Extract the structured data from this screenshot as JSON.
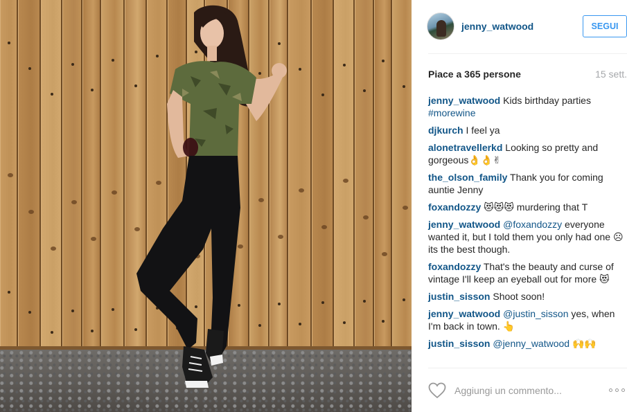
{
  "post": {
    "username": "jenny_watwood",
    "follow_label": "SEGUI",
    "likes_text": "Piace a 365 persone",
    "time_ago": "15 sett."
  },
  "comments": [
    {
      "user": "jenny_watwood",
      "text": "Kids birthday parties ",
      "tag": "#morewine"
    },
    {
      "user": "djkurch",
      "text": "I feel ya"
    },
    {
      "user": "alonetravellerkd",
      "text": "Looking so pretty and gorgeous👌👌✌"
    },
    {
      "user": "the_olson_family",
      "text": "Thank you for coming auntie Jenny"
    },
    {
      "user": "foxandozzy",
      "text": "😻😻😻 murdering that T"
    },
    {
      "user": "jenny_watwood",
      "mention": "@foxandozzy",
      "text": " everyone wanted it, but I told them you only had one ☹ its the best though."
    },
    {
      "user": "foxandozzy",
      "text": "That's the beauty and curse of vintage I'll keep an eyeball out for more 😻"
    },
    {
      "user": "justin_sisson",
      "text": "Shoot soon!"
    },
    {
      "user": "jenny_watwood",
      "mention": "@justin_sisson",
      "text": " yes, when I'm back in town. 👆"
    },
    {
      "user": "justin_sisson",
      "mention": "@jenny_watwood",
      "text": " 🙌🙌"
    }
  ],
  "footer": {
    "comment_placeholder": "Aggiungi un commento...",
    "like_icon": "heart-outline-icon",
    "more_icon": "more-options-icon"
  },
  "colors": {
    "username_blue": "#125688",
    "follow_blue": "#3897f0",
    "muted_gray": "#a5a7aa"
  }
}
